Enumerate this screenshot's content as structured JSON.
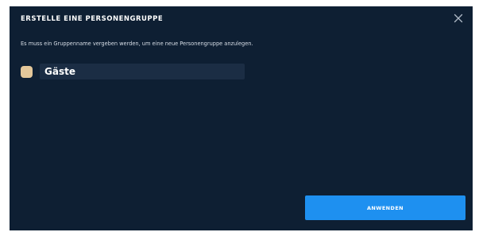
{
  "dialog": {
    "title": "ERSTELLE EINE PERSONENGRUPPE",
    "description": "Es muss ein Gruppenname vergeben werden, um eine neue Personengruppe anzulegen.",
    "close_icon": "close-icon",
    "group": {
      "name_value": "Gäste",
      "swatch_color": "#e3c79a"
    },
    "apply_label": "ANWENDEN"
  },
  "colors": {
    "dialog_background": "#0e1f33",
    "input_background": "#1b2d44",
    "accent": "#1e90f0"
  }
}
